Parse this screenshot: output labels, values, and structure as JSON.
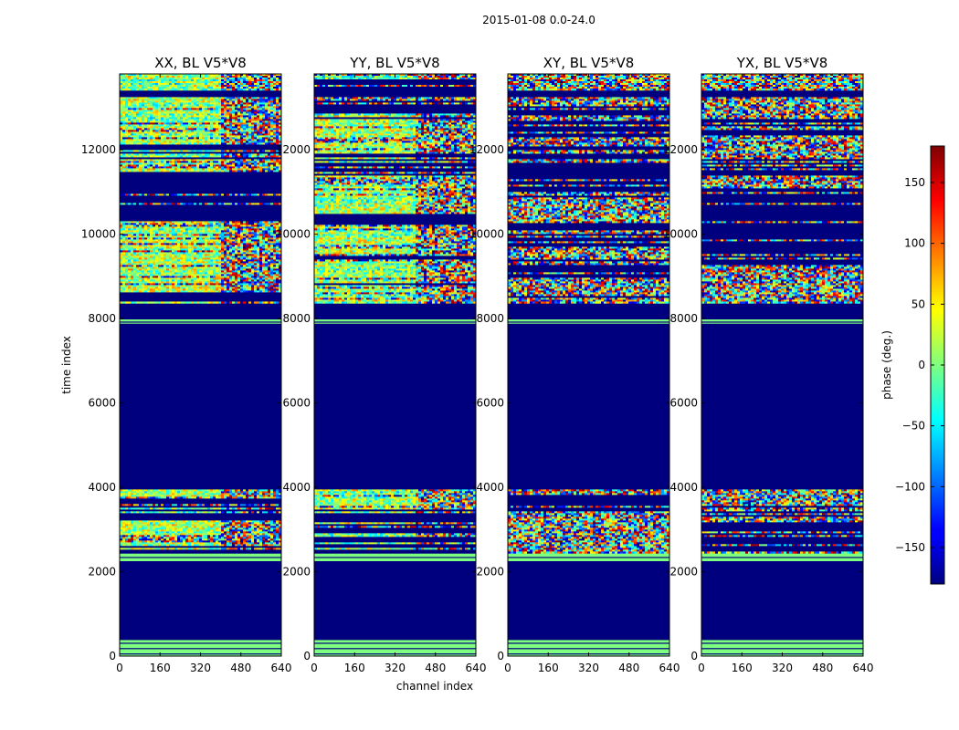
{
  "figure": {
    "suptitle": "2015-01-08 0.0-24.0"
  },
  "chart_data": {
    "type": "heatmap",
    "colormap": "jet",
    "xlabel": "channel index",
    "ylabel": "time index",
    "xticks": [
      0,
      160,
      320,
      480,
      640
    ],
    "yticks": [
      0,
      2000,
      4000,
      6000,
      8000,
      10000,
      12000
    ],
    "xlim": [
      0,
      640
    ],
    "ylim": [
      0,
      13800
    ],
    "panels": [
      {
        "title": "XX, BL V5*V8"
      },
      {
        "title": "YY, BL V5*V8"
      },
      {
        "title": "XY, BL V5*V8"
      },
      {
        "title": "YX, BL V5*V8"
      }
    ],
    "colorbar": {
      "label": "phase (deg.)",
      "ticks": [
        -150,
        -100,
        -50,
        0,
        50,
        100,
        150
      ],
      "range": [
        -180,
        180
      ]
    },
    "time_blocks": [
      {
        "t0": 0,
        "t1": 380,
        "kind": "calib"
      },
      {
        "t0": 380,
        "t1": 2250,
        "kind": "flagged"
      },
      {
        "t0": 2250,
        "t1": 2450,
        "kind": "calib"
      },
      {
        "t0": 2450,
        "t1": 3950,
        "kind": "data"
      },
      {
        "t0": 3950,
        "t1": 7880,
        "kind": "flagged"
      },
      {
        "t0": 7880,
        "t1": 7980,
        "kind": "calib"
      },
      {
        "t0": 7980,
        "t1": 8400,
        "kind": "flagged"
      },
      {
        "t0": 8400,
        "t1": 13250,
        "kind": "data"
      },
      {
        "t0": 13250,
        "t1": 13450,
        "kind": "flagged"
      },
      {
        "t0": 13450,
        "t1": 13800,
        "kind": "data"
      }
    ]
  }
}
